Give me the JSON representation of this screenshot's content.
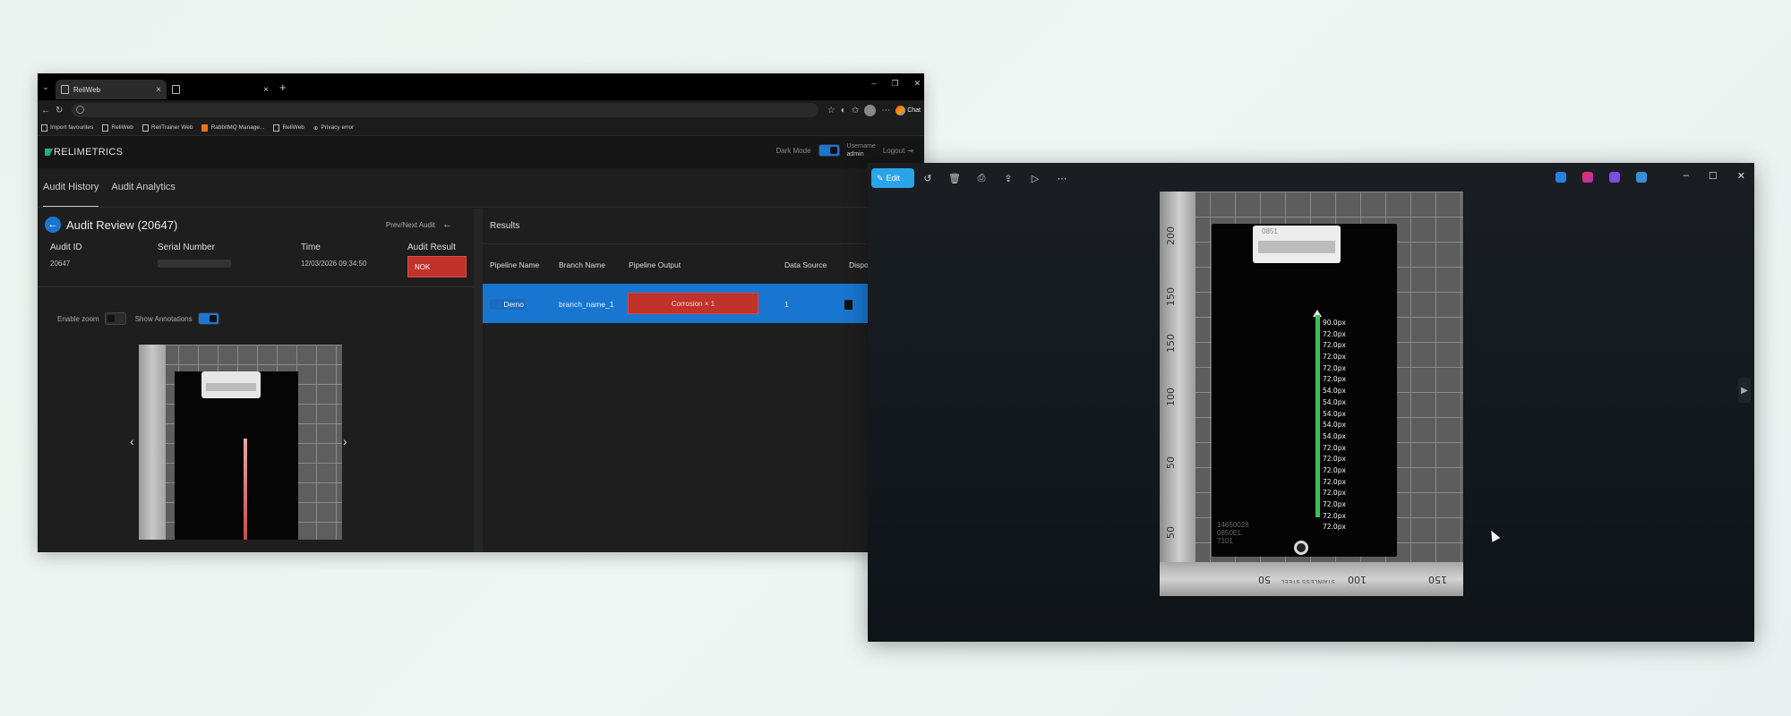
{
  "browser": {
    "tabs": [
      {
        "title": "ReliWeb"
      },
      {
        "title": ""
      }
    ],
    "bookmarks": [
      "Import favourites",
      "ReliWeb",
      "ReliTrainer Web",
      "RabbitMQ Manage...",
      "ReliWeb",
      "Privacy error"
    ],
    "chat_label": "Chat"
  },
  "app": {
    "logo": "RELIMETRICS",
    "dark_mode_label": "Dark Mode",
    "username_label": "Username",
    "username": "admin",
    "logout_label": "Logout",
    "nav": [
      "Audit History",
      "Audit Analytics"
    ]
  },
  "review": {
    "title": "Audit Review (20647)",
    "prev_next": "Prev/Next Audit",
    "headers": {
      "audit_id": "Audit ID",
      "serial": "Serial Number",
      "time": "Time",
      "result": "Audit Result"
    },
    "values": {
      "audit_id": "20647",
      "time": "12/03/2026 09:34:50",
      "result": "NOK"
    },
    "enable_zoom": "Enable zoom",
    "show_annotations": "Show Annotations"
  },
  "results": {
    "title": "Results",
    "columns": [
      "Pipeline Name",
      "Branch Name",
      "Pipeline Output",
      "Data Source",
      "Dispo"
    ],
    "row": {
      "pipeline": "Demo",
      "branch": "branch_name_1",
      "output": "Corrosion × 1",
      "source": "1"
    }
  },
  "viewer": {
    "edit_label": "Edit",
    "label_text": "0851",
    "ruler_vertical": [
      "200",
      "150",
      "150",
      "100",
      "50",
      "50"
    ],
    "ruler_horizontal": [
      "150",
      "100",
      "50"
    ],
    "ruler_text": "STAINLESS STEEL",
    "engraving": [
      "14650028",
      "0850EL",
      "7101"
    ],
    "measurements": [
      "90.0px",
      "72.0px",
      "72.0px",
      "72.0px",
      "72.0px",
      "72.0px",
      "54.0px",
      "54.0px",
      "54.0px",
      "54.0px",
      "54.0px",
      "72.0px",
      "72.0px",
      "72.0px",
      "72.0px",
      "72.0px",
      "72.0px",
      "72.0px",
      "72.0px"
    ]
  }
}
